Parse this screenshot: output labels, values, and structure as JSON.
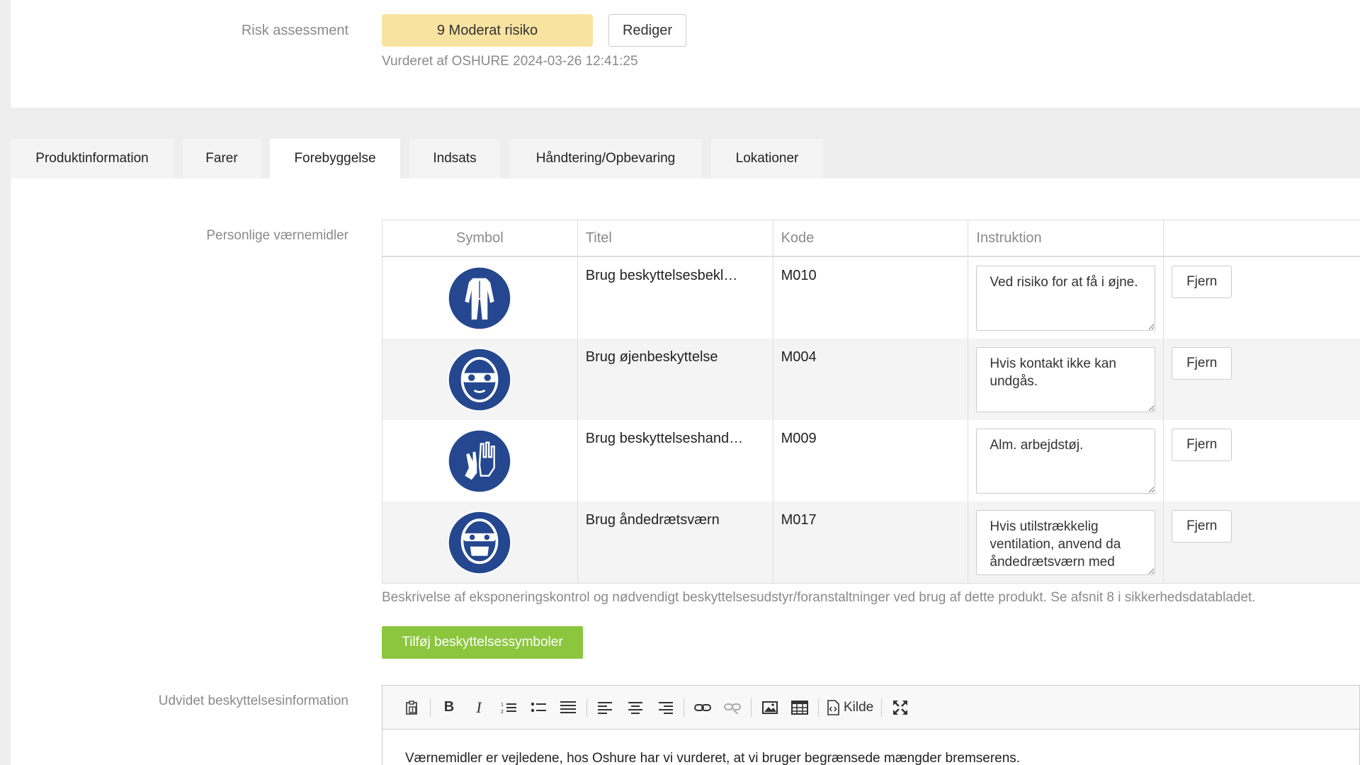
{
  "risk": {
    "label": "Risk assessment",
    "badge": "9 Moderat risiko",
    "badge_color": "#f8e3a0",
    "edit_label": "Rediger",
    "assessed_text": "Vurderet af OSHURE 2024-03-26 12:41:25"
  },
  "tabs": [
    {
      "label": "Produktinformation"
    },
    {
      "label": "Farer"
    },
    {
      "label": "Forebyggelse"
    },
    {
      "label": "Indsats"
    },
    {
      "label": "Håndtering/Opbevaring"
    },
    {
      "label": "Lokationer"
    }
  ],
  "active_tab": "Forebyggelse",
  "ppe": {
    "label": "Personlige værnemidler",
    "columns": {
      "symbol": "Symbol",
      "title": "Titel",
      "code": "Kode",
      "instruction": "Instruktion"
    },
    "rows": [
      {
        "symbol": "protective-clothing-icon",
        "title": "Brug beskyttelsesbekl…",
        "code": "M010",
        "instruction": "Ved risiko for at få i øjne.",
        "remove": "Fjern"
      },
      {
        "symbol": "eye-protection-icon",
        "title": "Brug øjenbeskyttelse",
        "code": "M004",
        "instruction": "Hvis kontakt ikke kan undgås.",
        "remove": "Fjern"
      },
      {
        "symbol": "gloves-icon",
        "title": "Brug beskyttelseshand…",
        "code": "M009",
        "instruction": "Alm. arbejdstøj.",
        "remove": "Fjern"
      },
      {
        "symbol": "respirator-icon",
        "title": "Brug åndedrætsværn",
        "code": "M017",
        "instruction": "Hvis utilstrækkelig ventilation, anvend da åndedrætsværn med",
        "remove": "Fjern"
      }
    ],
    "symbol_color": "#24478f",
    "description": "Beskrivelse af eksponeringskontrol og nødvendigt beskyttelsesudstyr/foranstaltninger ved brug af dette produkt. Se afsnit 8 i sikkerhedsdatabladet.",
    "add_label": "Tilføj beskyttelsessymboler",
    "add_color": "#8cc63f"
  },
  "extended": {
    "label": "Udvidet beskyttelsesinformation",
    "toolbar": {
      "source_label": "Kilde"
    },
    "body": "Værnemidler er vejledene, hos Oshure har vi vurderet, at vi bruger begrænsede mængder bremserens."
  }
}
